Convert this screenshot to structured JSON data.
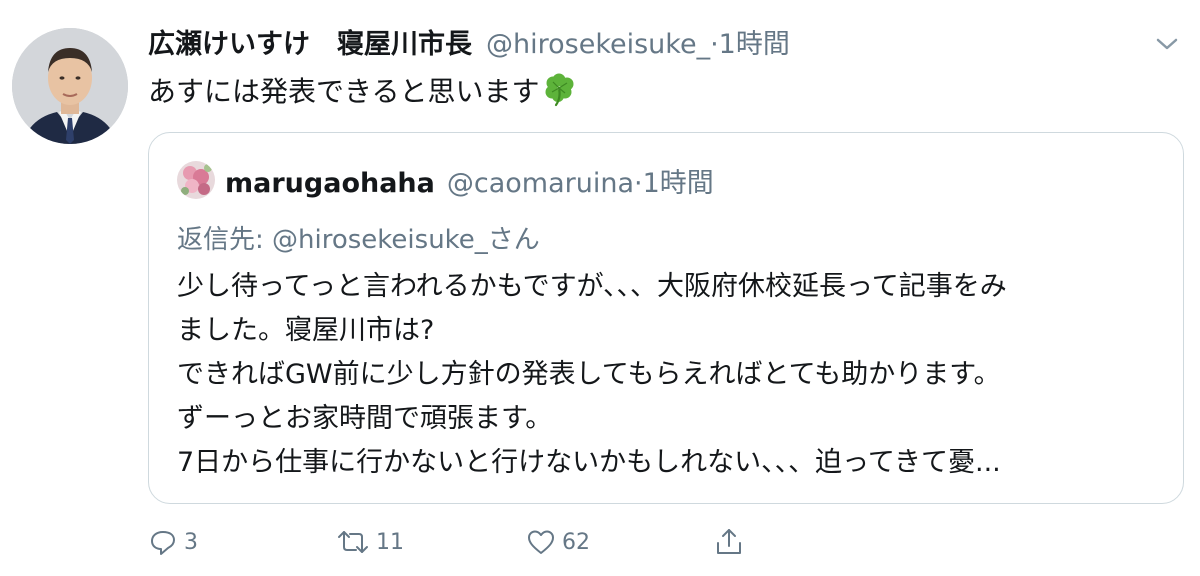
{
  "tweet": {
    "author_name": "広瀬けいすけ　寝屋川市長",
    "author_handle": "@hirosekeisuke_",
    "separator": "·",
    "time": "1時間",
    "text": "あすには発表できると思います",
    "emoji_icon": "four-leaf-clover-icon"
  },
  "quoted": {
    "author_name": "marugaohaha",
    "author_handle": "@caomaruina",
    "separator": "·",
    "time": "1時間",
    "reply_to": "返信先: @hirosekeisuke_さん",
    "lines": [
      "少し待ってっと言われるかもですが、、、大阪府休校延長って記事をみ",
      "ました。寝屋川市は?",
      "できればGW前に少し方針の発表してもらえればとても助かります。",
      "ずーっとお家時間で頑張ます。",
      "7日から仕事に行かないと行けないかもしれない、、、迫ってきて憂..."
    ]
  },
  "actions": {
    "reply_count": "3",
    "retweet_count": "11",
    "like_count": "62"
  },
  "colors": {
    "text": "#14171a",
    "secondary": "#657786",
    "border": "#cfd9de",
    "clover": "#5db33a"
  }
}
